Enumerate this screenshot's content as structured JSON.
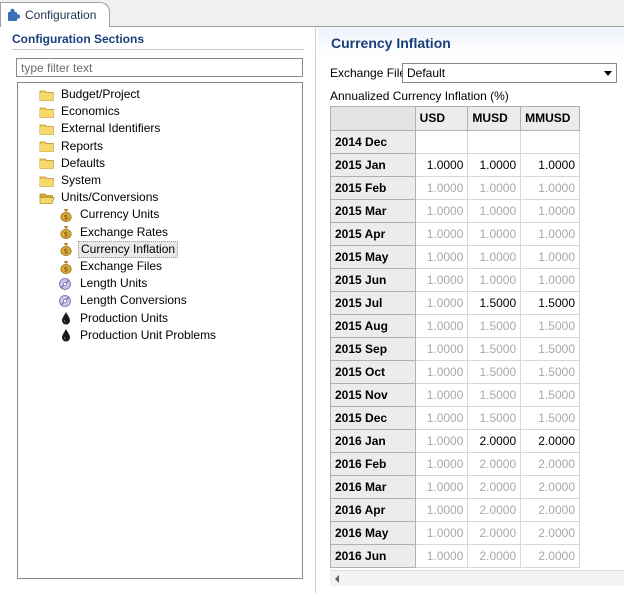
{
  "tab": {
    "title": "Configuration",
    "icon": "puzzle-icon"
  },
  "left": {
    "title": "Configuration Sections",
    "filter_placeholder": "type filter text",
    "tree": [
      {
        "label": "Budget/Project",
        "icon": "folder-icon"
      },
      {
        "label": "Economics",
        "icon": "folder-icon"
      },
      {
        "label": "External Identifiers",
        "icon": "folder-icon"
      },
      {
        "label": "Reports",
        "icon": "folder-icon"
      },
      {
        "label": "Defaults",
        "icon": "folder-icon"
      },
      {
        "label": "System",
        "icon": "folder-icon"
      },
      {
        "label": "Units/Conversions",
        "icon": "folder-open-icon"
      },
      {
        "label": "Currency Units",
        "icon": "money-bag-icon"
      },
      {
        "label": "Exchange Rates",
        "icon": "money-bag-icon"
      },
      {
        "label": "Currency Inflation",
        "icon": "money-bag-icon"
      },
      {
        "label": "Exchange Files",
        "icon": "money-bag-icon"
      },
      {
        "label": "Length Units",
        "icon": "ruler-icon"
      },
      {
        "label": "Length Conversions",
        "icon": "ruler-icon"
      },
      {
        "label": "Production Units",
        "icon": "oil-drop-icon"
      },
      {
        "label": "Production Unit Problems",
        "icon": "oil-drop-icon"
      }
    ],
    "selected": "Currency Inflation"
  },
  "right": {
    "title": "Currency Inflation",
    "exchange_file_label": "Exchange File",
    "exchange_file_value": "Default",
    "annualized_label": "Annualized Currency Inflation (%)",
    "columns": [
      "USD",
      "MUSD",
      "MMUSD"
    ],
    "rows": [
      {
        "label": "2014 Dec",
        "values": [
          "",
          "",
          ""
        ]
      },
      {
        "label": "2015 Jan",
        "values": [
          "1.0000",
          "1.0000",
          "1.0000"
        ],
        "edited": [
          true,
          true,
          true
        ]
      },
      {
        "label": "2015 Feb",
        "values": [
          "1.0000",
          "1.0000",
          "1.0000"
        ]
      },
      {
        "label": "2015 Mar",
        "values": [
          "1.0000",
          "1.0000",
          "1.0000"
        ]
      },
      {
        "label": "2015 Apr",
        "values": [
          "1.0000",
          "1.0000",
          "1.0000"
        ]
      },
      {
        "label": "2015 May",
        "values": [
          "1.0000",
          "1.0000",
          "1.0000"
        ]
      },
      {
        "label": "2015 Jun",
        "values": [
          "1.0000",
          "1.0000",
          "1.0000"
        ]
      },
      {
        "label": "2015 Jul",
        "values": [
          "1.0000",
          "1.5000",
          "1.5000"
        ],
        "edited": [
          false,
          true,
          true
        ]
      },
      {
        "label": "2015 Aug",
        "values": [
          "1.0000",
          "1.5000",
          "1.5000"
        ]
      },
      {
        "label": "2015 Sep",
        "values": [
          "1.0000",
          "1.5000",
          "1.5000"
        ]
      },
      {
        "label": "2015 Oct",
        "values": [
          "1.0000",
          "1.5000",
          "1.5000"
        ]
      },
      {
        "label": "2015 Nov",
        "values": [
          "1.0000",
          "1.5000",
          "1.5000"
        ]
      },
      {
        "label": "2015 Dec",
        "values": [
          "1.0000",
          "1.5000",
          "1.5000"
        ]
      },
      {
        "label": "2016 Jan",
        "values": [
          "1.0000",
          "2.0000",
          "2.0000"
        ],
        "edited": [
          false,
          true,
          true
        ]
      },
      {
        "label": "2016 Feb",
        "values": [
          "1.0000",
          "2.0000",
          "2.0000"
        ]
      },
      {
        "label": "2016 Mar",
        "values": [
          "1.0000",
          "2.0000",
          "2.0000"
        ]
      },
      {
        "label": "2016 Apr",
        "values": [
          "1.0000",
          "2.0000",
          "2.0000"
        ]
      },
      {
        "label": "2016 May",
        "values": [
          "1.0000",
          "2.0000",
          "2.0000"
        ]
      },
      {
        "label": "2016 Jun",
        "values": [
          "1.0000",
          "2.0000",
          "2.0000"
        ]
      }
    ]
  }
}
